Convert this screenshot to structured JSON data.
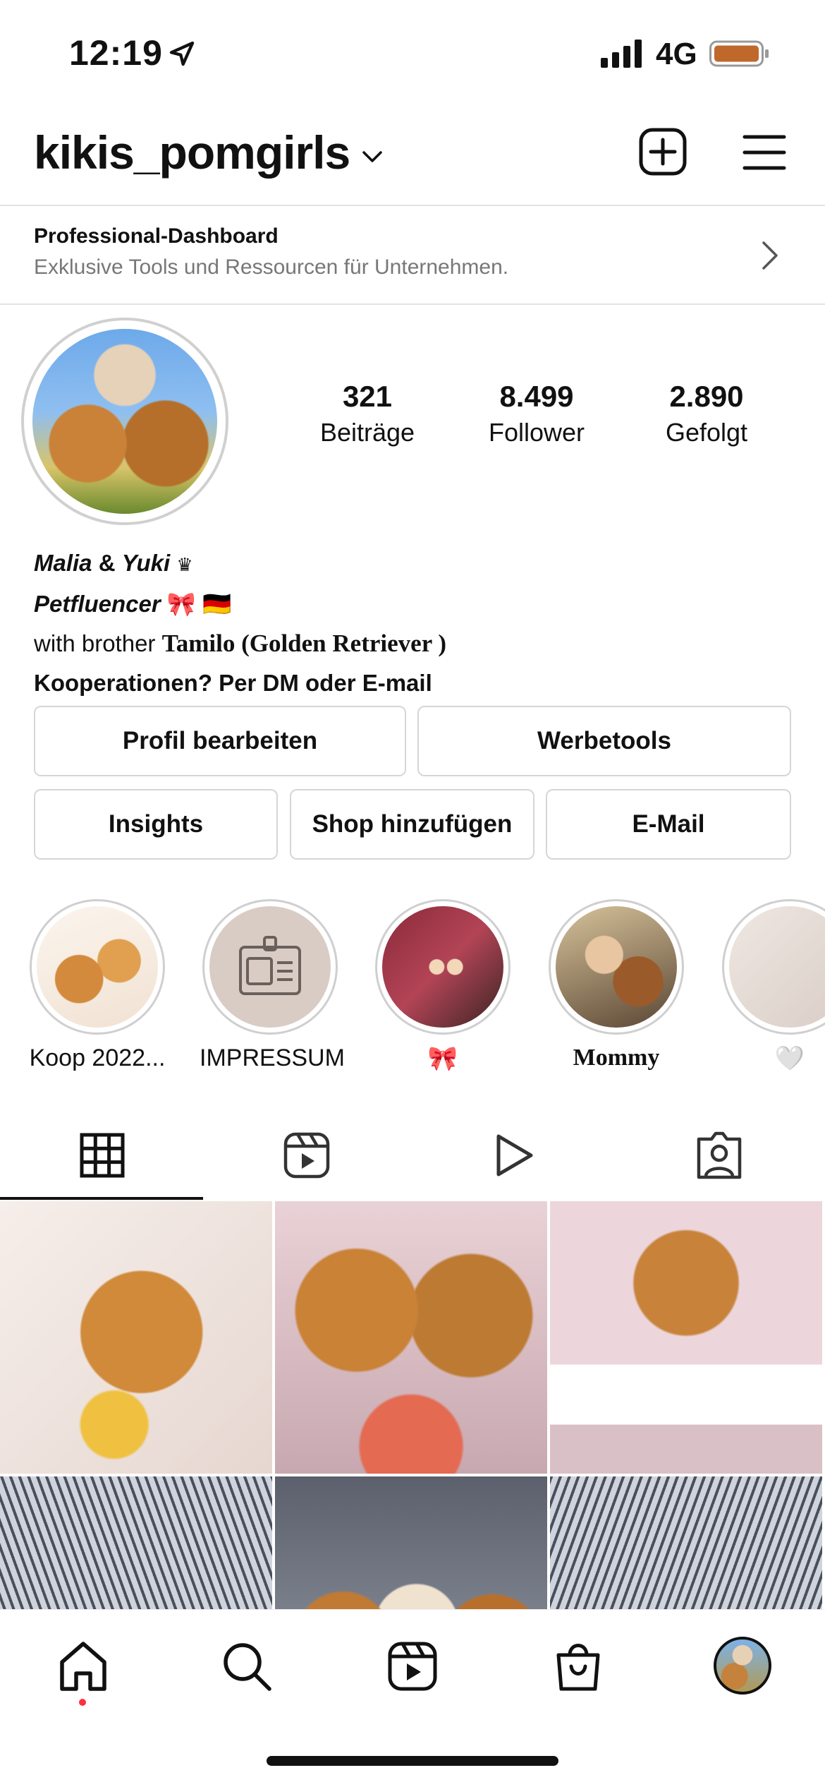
{
  "status_bar": {
    "time": "12:19",
    "network": "4G"
  },
  "header": {
    "username": "kikis_pomgirls"
  },
  "dashboard": {
    "title": "Professional-Dashboard",
    "subtitle": "Exklusive Tools und Ressourcen für Unternehmen."
  },
  "stats": [
    {
      "value": "321",
      "label": "Beiträge"
    },
    {
      "value": "8.499",
      "label": "Follower"
    },
    {
      "value": "2.890",
      "label": "Gefolgt"
    }
  ],
  "bio": {
    "line1_name1": "Malia",
    "line1_amp": " & ",
    "line1_name2": "Yuki",
    "line1_icon": "♛",
    "line2_role": "Petfluencer",
    "line2_emoji": "🎀 🇩🇪",
    "line3_prefix": "with brother ",
    "line3_name": "Tamilo (Golden Retriever )",
    "line4": "Kooperationen? Per DM oder E-mail"
  },
  "buttons": {
    "edit_profile": "Profil bearbeiten",
    "ad_tools": "Werbetools",
    "insights": "Insights",
    "add_shop": "Shop hinzufügen",
    "email": "E-Mail"
  },
  "highlights": [
    {
      "label": "Koop 2022..."
    },
    {
      "label": "IMPRESSUM"
    },
    {
      "label": "🎀"
    },
    {
      "label": "Mommy"
    },
    {
      "label": "🤍"
    }
  ],
  "icons": {
    "location": "location-arrow-icon",
    "signal": "signal-bars-icon",
    "battery": "battery-icon",
    "dropdown": "chevron-down-icon",
    "add": "plus-square-icon",
    "menu": "hamburger-menu-icon",
    "grid": "grid-icon",
    "reels": "reels-icon",
    "video": "play-icon",
    "tagged": "tagged-person-icon",
    "home": "home-icon",
    "search": "search-icon",
    "shop": "shopping-bag-icon"
  },
  "colors": {
    "notification_dot": "#ff3040",
    "battery_fill": "#c0672b"
  }
}
